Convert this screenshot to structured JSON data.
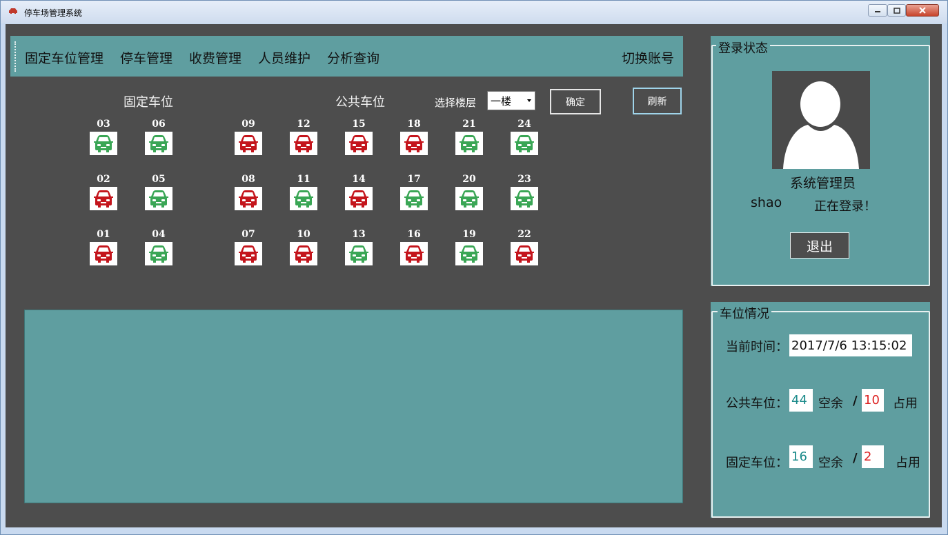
{
  "window": {
    "title": "停车场管理系统"
  },
  "nav": {
    "items": [
      "固定车位管理",
      "停车管理",
      "收费管理",
      "人员维护",
      "分析查询"
    ],
    "switch_account": "切换账号"
  },
  "parking": {
    "fixed_title": "固定车位",
    "public_title": "公共车位",
    "floor_label": "选择楼层",
    "floor_value": "一楼",
    "confirm_label": "确定",
    "refresh_label": "刷新",
    "slot_colors": {
      "free": "#3aa655",
      "occupied": "#c4151c"
    },
    "fixed_columns": [
      [
        {
          "id": "03",
          "status": "free"
        },
        {
          "id": "02",
          "status": "occupied"
        },
        {
          "id": "01",
          "status": "occupied"
        }
      ],
      [
        {
          "id": "06",
          "status": "free"
        },
        {
          "id": "05",
          "status": "free"
        },
        {
          "id": "04",
          "status": "free"
        }
      ]
    ],
    "public_columns": [
      [
        {
          "id": "09",
          "status": "occupied"
        },
        {
          "id": "08",
          "status": "occupied"
        },
        {
          "id": "07",
          "status": "occupied"
        }
      ],
      [
        {
          "id": "12",
          "status": "occupied"
        },
        {
          "id": "11",
          "status": "free"
        },
        {
          "id": "10",
          "status": "occupied"
        }
      ],
      [
        {
          "id": "15",
          "status": "occupied"
        },
        {
          "id": "14",
          "status": "occupied"
        },
        {
          "id": "13",
          "status": "free"
        }
      ],
      [
        {
          "id": "18",
          "status": "occupied"
        },
        {
          "id": "17",
          "status": "free"
        },
        {
          "id": "16",
          "status": "occupied"
        }
      ],
      [
        {
          "id": "21",
          "status": "free"
        },
        {
          "id": "20",
          "status": "free"
        },
        {
          "id": "19",
          "status": "free"
        }
      ],
      [
        {
          "id": "24",
          "status": "free"
        },
        {
          "id": "23",
          "status": "free"
        },
        {
          "id": "22",
          "status": "occupied"
        }
      ]
    ]
  },
  "login": {
    "group_title": "登录状态",
    "role": "系统管理员",
    "username": "shao",
    "status": "正在登录！",
    "logout_label": "退出"
  },
  "slot_status": {
    "group_title": "车位情况",
    "time_label": "当前时间：",
    "time_value": "2017/7/6 13:15:02",
    "public_label": "公共车位：",
    "public_free": "44",
    "public_used": "10",
    "fixed_label": "固定车位：",
    "fixed_free": "16",
    "fixed_used": "2",
    "free_word": "空余",
    "used_word": "占用",
    "separator": "/"
  }
}
